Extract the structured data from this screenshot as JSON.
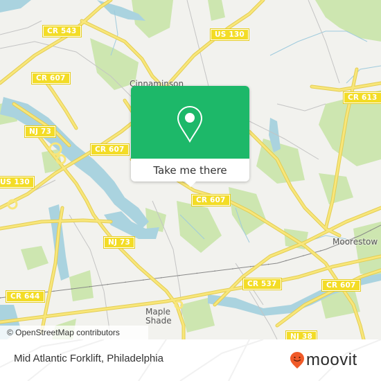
{
  "map": {
    "colors": {
      "land": "#f2f2ee",
      "water": "#aad3df",
      "park": "#cde6b0",
      "road": "#f7e470",
      "road_casing": "#e0c84a",
      "minor_road": "#b9b9b9",
      "rail": "#777777"
    },
    "route_shields": [
      {
        "id": "cr543",
        "label": "CR 543"
      },
      {
        "id": "us130-top",
        "label": "US 130"
      },
      {
        "id": "cr607-nw",
        "label": "CR 607"
      },
      {
        "id": "cr613",
        "label": "CR 613"
      },
      {
        "id": "nj73-w",
        "label": "NJ 73"
      },
      {
        "id": "cr607-w",
        "label": "CR 607"
      },
      {
        "id": "us130-w",
        "label": "US 130"
      },
      {
        "id": "cr607-center",
        "label": "CR 607"
      },
      {
        "id": "nj73-s",
        "label": "NJ 73"
      },
      {
        "id": "cr644",
        "label": "CR 644"
      },
      {
        "id": "cr537",
        "label": "CR 537"
      },
      {
        "id": "cr607-se",
        "label": "CR 607"
      },
      {
        "id": "nj38",
        "label": "NJ 38"
      }
    ],
    "places": [
      {
        "id": "cinnaminson",
        "label": "Cinnaminson"
      },
      {
        "id": "moorestown",
        "label": "Moorestow"
      },
      {
        "id": "maple-shade",
        "label": "Maple\nShade"
      }
    ],
    "attribution": "© OpenStreetMap contributors"
  },
  "popup": {
    "icon": "map-pin-icon",
    "button_label": "Take me there",
    "color": "#1db869"
  },
  "footer": {
    "title": "Mid Atlantic Forklift, Philadelphia",
    "brand": "moovit",
    "brand_icon": "moovit-smiley-pin-icon",
    "brand_color": "#f05a28"
  }
}
